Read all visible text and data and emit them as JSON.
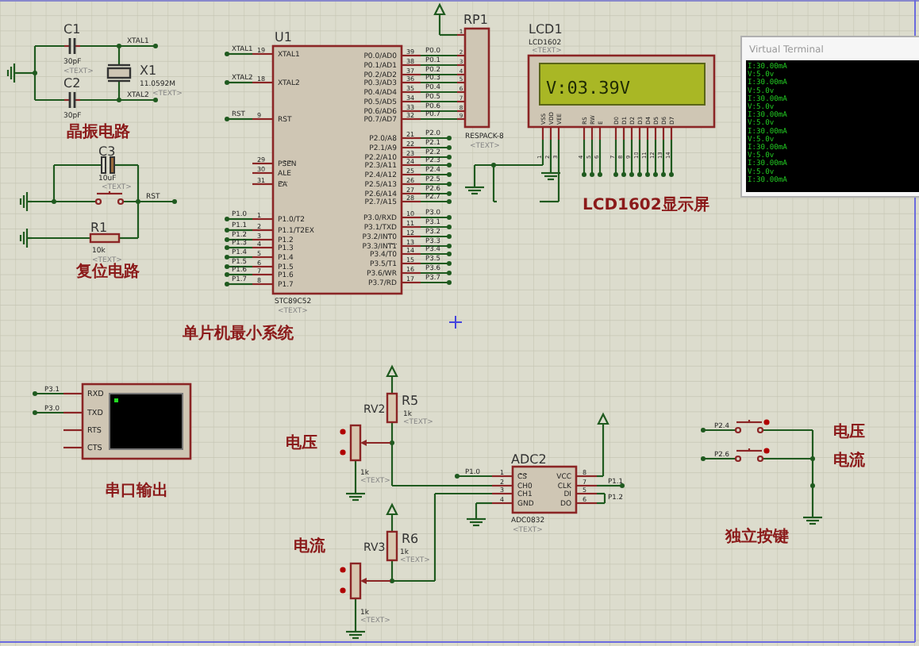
{
  "crystal_circuit": {
    "title": "晶振电路",
    "net_labels": [
      "XTAL1",
      "XTAL2"
    ],
    "parts": [
      {
        "kind": "capacitor",
        "ref": "C1",
        "value": "30pF",
        "text": "<TEXT>"
      },
      {
        "kind": "capacitor",
        "ref": "C2",
        "value": "30pF"
      },
      {
        "kind": "crystal",
        "ref": "X1",
        "value": "11.0592M",
        "text": "<TEXT>"
      }
    ]
  },
  "reset_circuit": {
    "title": "复位电路",
    "net_labels": [
      "RST"
    ],
    "parts": [
      {
        "kind": "electrolytic",
        "ref": "C3",
        "value": "10uF"
      },
      {
        "kind": "button",
        "text": "<TEXT>"
      },
      {
        "kind": "resistor",
        "ref": "R1",
        "value": "10k",
        "text": "<TEXT>"
      }
    ]
  },
  "mcu": {
    "title": "单片机最小系统",
    "ref": "U1",
    "part": "STC89C52",
    "text": "<TEXT>",
    "left_pins": [
      {
        "name": "XTAL1",
        "number": "19",
        "net": "XTAL1"
      },
      {
        "name": "XTAL2",
        "number": "18",
        "net": "XTAL2"
      },
      {
        "name": "RST",
        "number": "9",
        "net": "RST"
      },
      {
        "bar": "PSEN",
        "number": "29"
      },
      {
        "name": "ALE",
        "number": "30"
      },
      {
        "bar": "EA",
        "number": "31"
      },
      {
        "name": "P1.0/T2",
        "number": "1",
        "net": "P1.0"
      },
      {
        "name": "P1.1/T2EX",
        "number": "2",
        "net": "P1.1"
      },
      {
        "name": "P1.2",
        "number": "3",
        "net": "P1.2"
      },
      {
        "name": "P1.3",
        "number": "4",
        "net": "P1.3"
      },
      {
        "name": "P1.4",
        "number": "5",
        "net": "P1.4"
      },
      {
        "name": "P1.5",
        "number": "6",
        "net": "P1.5"
      },
      {
        "name": "P1.6",
        "number": "7",
        "net": "P1.6"
      },
      {
        "name": "P1.7",
        "number": "8",
        "net": "P1.7"
      }
    ],
    "right_pins": [
      {
        "name": "P0.0/AD0",
        "number": "39",
        "net": "P0.0"
      },
      {
        "name": "P0.1/AD1",
        "number": "38",
        "net": "P0.1"
      },
      {
        "name": "P0.2/AD2",
        "number": "37",
        "net": "P0.2"
      },
      {
        "name": "P0.3/AD3",
        "number": "36",
        "net": "P0.3"
      },
      {
        "name": "P0.4/AD4",
        "number": "35",
        "net": "P0.4"
      },
      {
        "name": "P0.5/AD5",
        "number": "34",
        "net": "P0.5"
      },
      {
        "name": "P0.6/AD6",
        "number": "33",
        "net": "P0.6"
      },
      {
        "name": "P0.7/AD7",
        "number": "32",
        "net": "P0.7"
      },
      {
        "name": "P2.0/A8",
        "number": "21",
        "net": "P2.0"
      },
      {
        "name": "P2.1/A9",
        "number": "22",
        "net": "P2.1"
      },
      {
        "name": "P2.2/A10",
        "number": "23",
        "net": "P2.2"
      },
      {
        "name": "P2.3/A11",
        "number": "24",
        "net": "P2.3"
      },
      {
        "name": "P2.4/A12",
        "number": "25",
        "net": "P2.4"
      },
      {
        "name": "P2.5/A13",
        "number": "26",
        "net": "P2.5"
      },
      {
        "name": "P2.6/A14",
        "number": "27",
        "net": "P2.6"
      },
      {
        "name": "P2.7/A15",
        "number": "28",
        "net": "P2.7"
      },
      {
        "name": "P3.0/RXD",
        "number": "10",
        "net": "P3.0"
      },
      {
        "name": "P3.1/TXD",
        "number": "11",
        "net": "P3.1"
      },
      {
        "name": "P3.2/",
        "bar": "INT0",
        "number": "12",
        "net": "P3.2"
      },
      {
        "name": "P3.3/",
        "bar": "INT1",
        "number": "13",
        "net": "P3.3"
      },
      {
        "name": "P3.4/T0",
        "number": "14",
        "net": "P3.4"
      },
      {
        "name": "P3.5/T1",
        "number": "15",
        "net": "P3.5"
      },
      {
        "name": "P3.6/",
        "bar": "WR",
        "number": "16",
        "net": "P3.6"
      },
      {
        "name": "P3.7/",
        "bar": "RD",
        "number": "17",
        "net": "P3.7"
      }
    ]
  },
  "respack": {
    "ref": "RP1",
    "part": "RESPACK-8",
    "text": "<TEXT>",
    "pins": [
      "1",
      "2",
      "3",
      "4",
      "5",
      "6",
      "7",
      "8",
      "9"
    ]
  },
  "lcd": {
    "title": "LCD1602显示屏",
    "ref": "LCD1",
    "part": "LCD1602",
    "text": "<TEXT>",
    "display": "V:03.39V",
    "pins": [
      {
        "name": "VSS",
        "number": "1"
      },
      {
        "name": "VDD",
        "number": "2"
      },
      {
        "name": "VEE",
        "number": "3"
      },
      {
        "name": "RS",
        "number": "4"
      },
      {
        "name": "RW",
        "number": "5"
      },
      {
        "name": "E",
        "number": "6"
      },
      {
        "name": "D0",
        "number": "7"
      },
      {
        "name": "D1",
        "number": "8"
      },
      {
        "name": "D2",
        "number": "9"
      },
      {
        "name": "D3",
        "number": "10"
      },
      {
        "name": "D4",
        "number": "11"
      },
      {
        "name": "D5",
        "number": "12"
      },
      {
        "name": "D6",
        "number": "13"
      },
      {
        "name": "D7",
        "number": "14"
      }
    ]
  },
  "potential_divider": {
    "parts": [
      {
        "kind": "resistor",
        "ref": "R5",
        "value": "1k",
        "text": "<TEXT>"
      },
      {
        "kind": "pot",
        "ref": "RV2",
        "value": "1k",
        "text": "<TEXT>"
      },
      {
        "kind": "resistor",
        "ref": "R6",
        "value": "1k",
        "text": "<TEXT>"
      },
      {
        "kind": "pot",
        "ref": "RV3",
        "value": "1k",
        "text": "<TEXT>"
      }
    ],
    "labels": [
      "电压",
      "电流"
    ]
  },
  "adc": {
    "ref": "ADC2",
    "part": "ADC0832",
    "text": "<TEXT>",
    "left_pins": [
      {
        "bar": "CS",
        "number": "1",
        "net": "P1.0"
      },
      {
        "name": "CH0",
        "number": "2"
      },
      {
        "name": "CH1",
        "number": "3"
      },
      {
        "name": "GND",
        "number": "4"
      }
    ],
    "right_pins": [
      {
        "name": "VCC",
        "number": "8"
      },
      {
        "name": "CLK",
        "number": "7",
        "net": "P1.1"
      },
      {
        "name": "DI",
        "number": "5",
        "net": "P1.2"
      },
      {
        "name": "DO",
        "number": "6"
      }
    ]
  },
  "serial_terminal": {
    "title": "串口输出",
    "pins": [
      {
        "name": "RXD",
        "net": "P3.1"
      },
      {
        "name": "TXD",
        "net": "P3.0"
      },
      {
        "name": "RTS"
      },
      {
        "name": "CTS"
      }
    ]
  },
  "keys": {
    "title": "独立按键",
    "items": [
      {
        "net": "P2.4",
        "label": "电压"
      },
      {
        "net": "P2.6",
        "label": "电流"
      }
    ]
  },
  "virtual_terminal": {
    "title": "Virtual Terminal",
    "lines": [
      "I:30.00mA",
      "V:5.0v",
      "I:30.00mA",
      "V:5.0v",
      "I:30.00mA",
      "V:5.0v",
      "I:30.00mA",
      "V:5.0v",
      "I:30.00mA",
      "V:5.0v",
      "I:30.00mA",
      "V:5.0v",
      "I:30.00mA",
      "V:5.0v",
      "I:30.00mA"
    ]
  }
}
